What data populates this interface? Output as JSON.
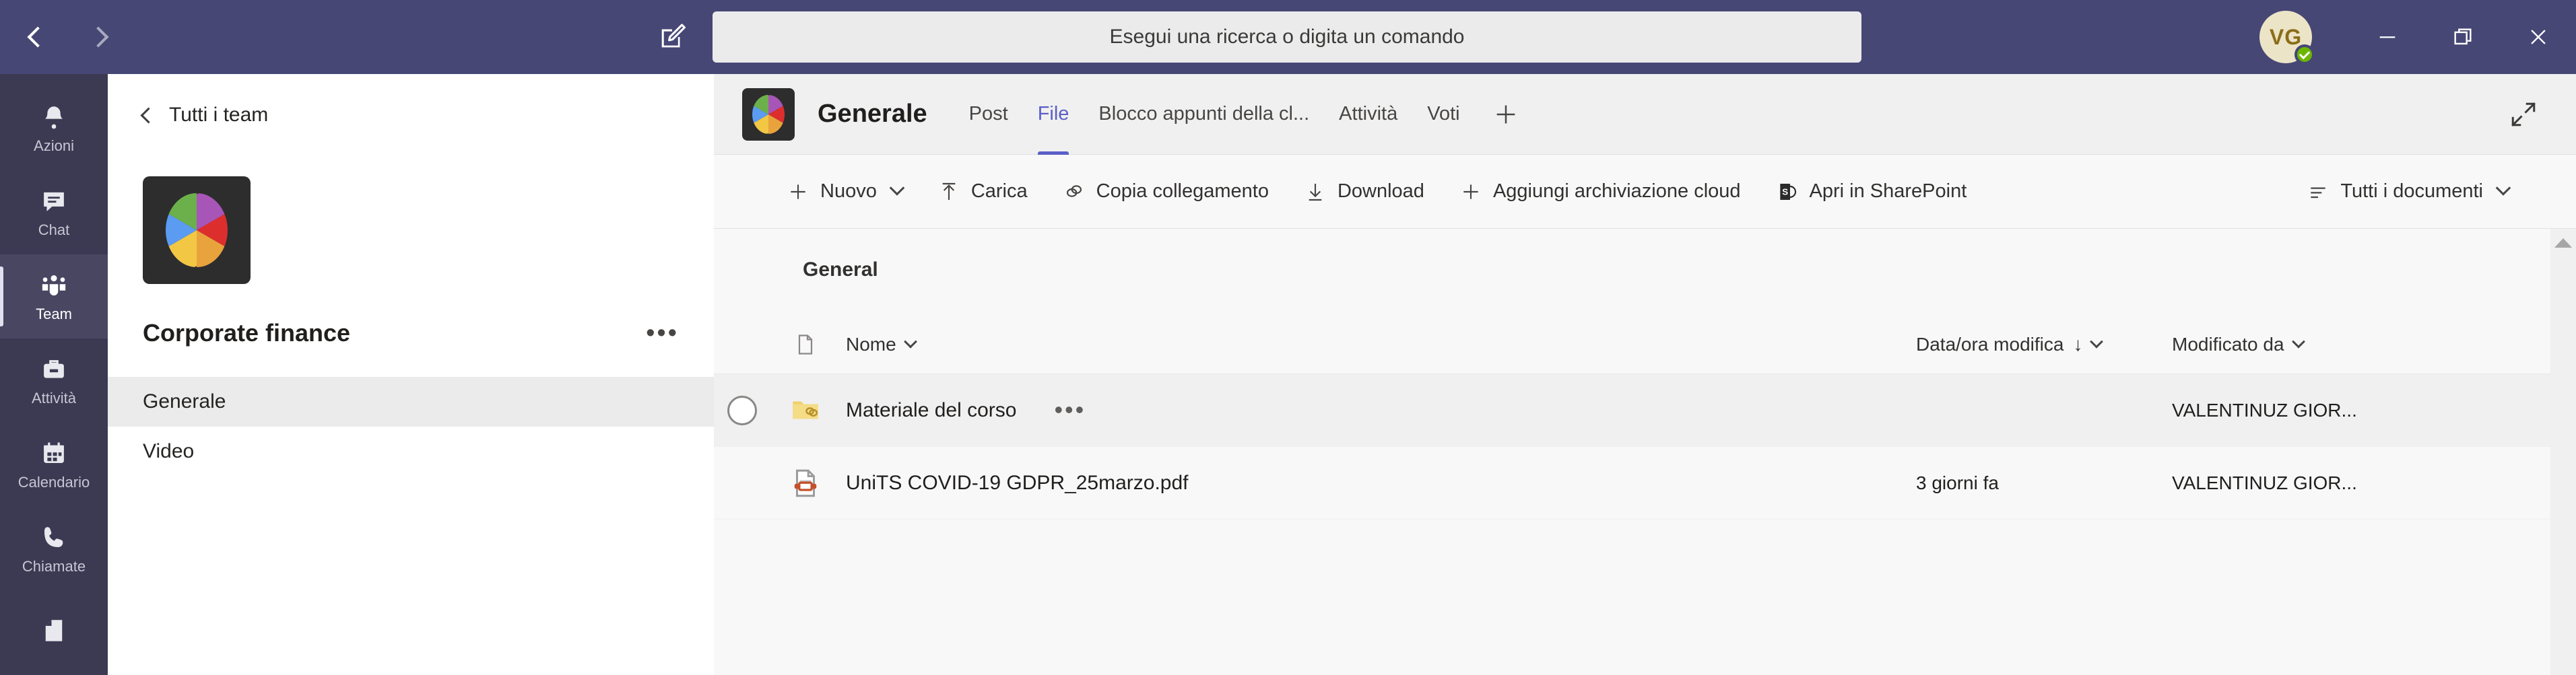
{
  "titlebar": {
    "back_icon": "chevron-left-icon",
    "forward_icon": "chevron-right-icon",
    "compose_icon": "compose-pencil-icon",
    "search_placeholder": "Esegui una ricerca o digita un comando",
    "avatar_initials": "VG",
    "presence": "available",
    "minimize_label": "—",
    "maximize_label": "❐",
    "close_label": "✕",
    "bg_color": "#464775"
  },
  "rail": {
    "items": [
      {
        "label": "Azioni",
        "icon": "bell-icon",
        "active": false
      },
      {
        "label": "Chat",
        "icon": "chat-bubble-icon",
        "active": false
      },
      {
        "label": "Team",
        "icon": "people-team-icon",
        "active": true
      },
      {
        "label": "Attività",
        "icon": "briefcase-icon",
        "active": false
      },
      {
        "label": "Calendario",
        "icon": "calendar-icon",
        "active": false
      },
      {
        "label": "Chiamate",
        "icon": "phone-icon",
        "active": false
      },
      {
        "label": "",
        "icon": "file-document-icon",
        "active": false
      }
    ]
  },
  "panel": {
    "back_label": "Tutti i team",
    "team_name": "Corporate finance",
    "team_options_label": "•••",
    "channels": [
      {
        "label": "Generale",
        "active": true
      },
      {
        "label": "Video",
        "active": false
      }
    ]
  },
  "channel_header": {
    "title": "Generale",
    "tabs": [
      {
        "label": "Post",
        "active": false
      },
      {
        "label": "File",
        "active": true
      },
      {
        "label": "Blocco appunti della cl...",
        "active": false
      },
      {
        "label": "Attività",
        "active": false
      },
      {
        "label": "Voti",
        "active": false
      }
    ],
    "add_tab_label": "+",
    "expand_icon": "expand-diagonal-icon",
    "accent_color": "#5b5fc7"
  },
  "toolbar": {
    "items": [
      {
        "label": "Nuovo",
        "icon": "plus-icon",
        "caret": true
      },
      {
        "label": "Carica",
        "icon": "upload-arrow-icon",
        "caret": false
      },
      {
        "label": "Copia collegamento",
        "icon": "link-icon",
        "caret": false
      },
      {
        "label": "Download",
        "icon": "download-arrow-icon",
        "caret": false
      },
      {
        "label": "Aggiungi archiviazione cloud",
        "icon": "plus-icon",
        "caret": false
      },
      {
        "label": "Apri in SharePoint",
        "icon": "sharepoint-icon",
        "caret": false
      }
    ],
    "view_label": "Tutti i documenti",
    "view_icon": "list-view-icon"
  },
  "files": {
    "breadcrumb": "General",
    "columns": {
      "name": "Nome",
      "modified": "Data/ora modifica",
      "modified_by": "Modificato da",
      "sort_indicator": "↓"
    },
    "rows": [
      {
        "name": "Materiale del corso",
        "icon": "folder-shared-icon",
        "modified": "",
        "modified_by": "VALENTINUZ GIOR...",
        "hovered": true,
        "has_checkbox": true,
        "has_menu": true,
        "menu_label": "•••"
      },
      {
        "name": "UniTS COVID-19 GDPR_25marzo.pdf",
        "icon": "pdf-file-icon",
        "modified": "3 giorni fa",
        "modified_by": "VALENTINUZ GIOR...",
        "hovered": false,
        "has_checkbox": false,
        "has_menu": false,
        "menu_label": ""
      }
    ]
  },
  "scrollbar": {
    "up_arrow": "scroll-up-arrow-icon"
  }
}
